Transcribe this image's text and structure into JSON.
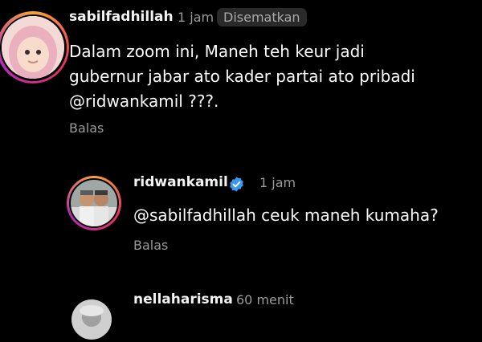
{
  "comments": [
    {
      "username": "sabilfadhillah",
      "time": "1 jam",
      "pinned_label": "Disematkan",
      "lines": [
        "Dalam zoom ini, Maneh teh keur jadi",
        "gubernur jabar ato kader partai ato pribadi",
        "@ridwankamil ???."
      ],
      "reply_label": "Balas"
    },
    {
      "username": "ridwankamil",
      "time": "1 jam",
      "verified": true,
      "text": "@sabilfadhillah ceuk maneh kumaha?",
      "reply_label": "Balas"
    },
    {
      "username": "nellaharisma",
      "time": "60 menit"
    }
  ],
  "colors": {
    "background": "#000000",
    "verified_badge": "#3897f0",
    "story_ring": "#e8305f"
  }
}
